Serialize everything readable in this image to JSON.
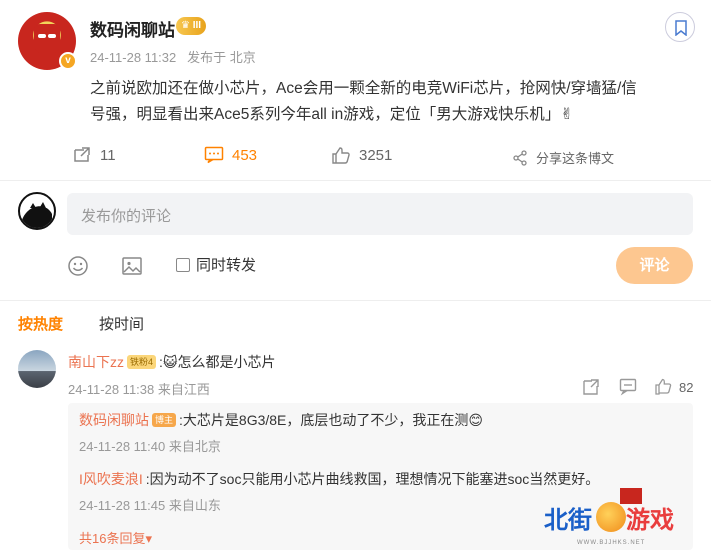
{
  "post": {
    "author": "数码闲聊站",
    "vip_badge": "III",
    "verified_badge": "v",
    "timestamp": "24-11-28 11:32",
    "location": "发布于 北京",
    "content_line1": "之前说欧加还在做小芯片，Ace会用一颗全新的电竞WiFi芯片，抢网快/穿墙猛/信",
    "content_line2": "号强，明显看出来Ace5系列今年all in游戏，定位「男大游戏快乐机」✌",
    "reposts": "11",
    "comments": "453",
    "likes": "3251",
    "share_label": "分享这条博文"
  },
  "composer": {
    "placeholder": "发布你的评论",
    "forward_label": "同时转发",
    "submit_label": "评论"
  },
  "sort_tabs": {
    "hot": "按热度",
    "time": "按时间"
  },
  "comment": {
    "user": "南山下zz",
    "fan_badge": "铁粉4",
    "text": ":😺怎么都是小芯片",
    "meta": "24-11-28 11:38 来自江西",
    "likes": "82"
  },
  "replies": [
    {
      "user": "数码闲聊站",
      "badge": "博主",
      "text": ":大芯片是8G3/8E，底层也动了不少，我正在测😊",
      "meta": "24-11-28 11:40 来自北京"
    },
    {
      "user": "I风吹麦浪I",
      "text": ":因为动不了soc只能用小芯片曲线救国，理想情况下能塞进soc当然更好。",
      "meta": "24-11-28 11:45 来自山东"
    }
  ],
  "more_replies": "共16条回复▾",
  "watermark": {
    "left": "北街",
    "right": "游戏",
    "sub": "WWW.BJJHKS.NET"
  },
  "colors": {
    "accent": "#ff8200",
    "username": "#eb7350",
    "submit_bg": "#fdc790"
  }
}
